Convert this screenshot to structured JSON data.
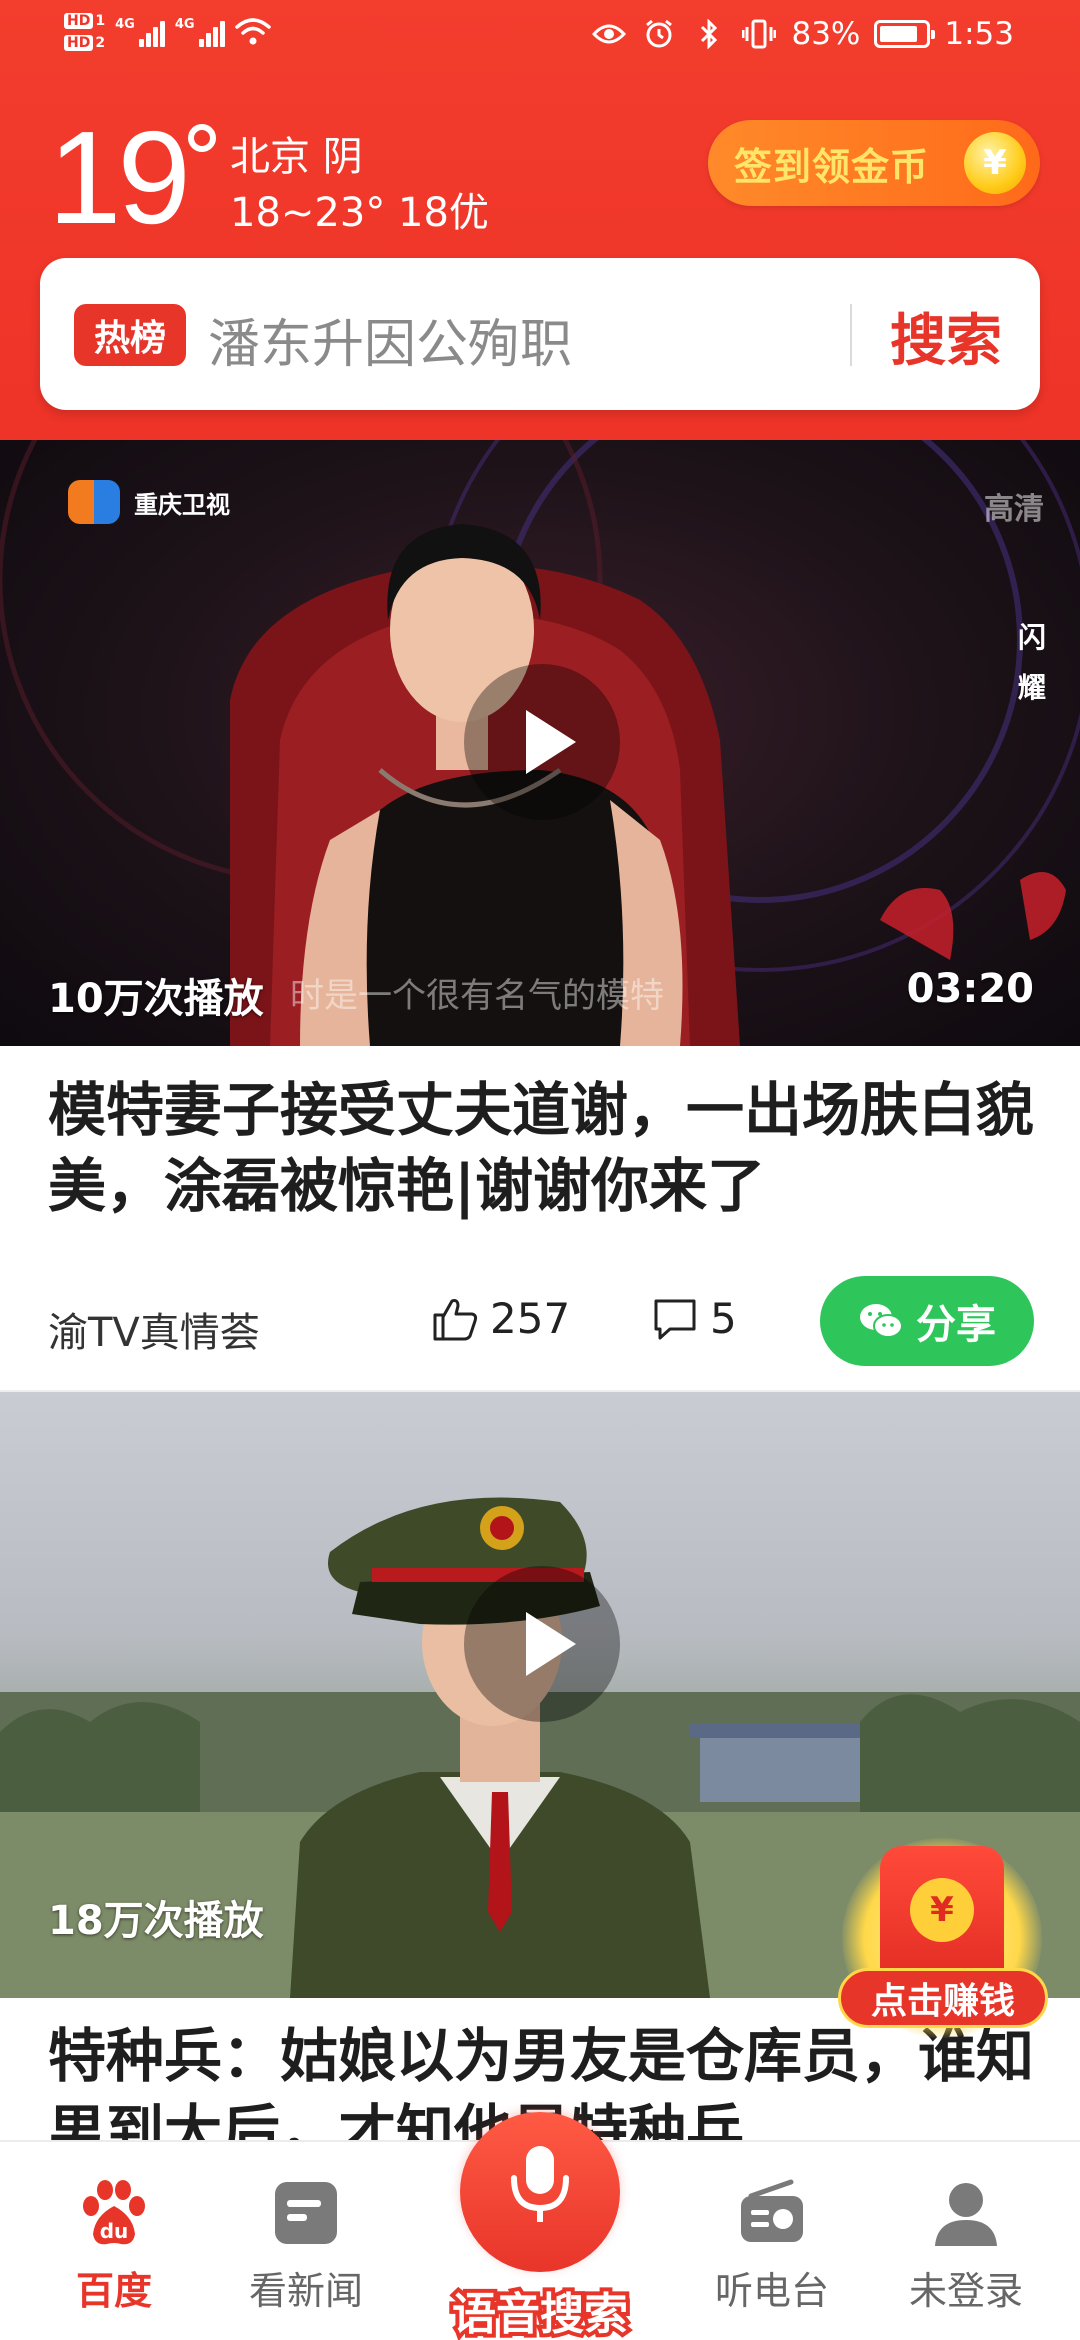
{
  "status_bar": {
    "sim1": "1",
    "sim2": "2",
    "net1": "4G",
    "net2": "4G",
    "battery_percent": "83%",
    "battery_level": 0.83,
    "time": "1:53",
    "icons": [
      "eye-icon",
      "alarm-icon",
      "bluetooth-icon",
      "vibrate-icon",
      "battery-icon"
    ]
  },
  "weather": {
    "temperature": "19",
    "city_line": "北京 阴",
    "range_line": "18~23° 18优"
  },
  "signin": {
    "label": "签到领金币",
    "coin_symbol": "¥"
  },
  "search": {
    "badge": "热榜",
    "query": "潘东升因公殉职",
    "button": "搜索"
  },
  "feed": {
    "item1": {
      "channel": "重庆卫视",
      "hd_tag": "高清",
      "side_tag_1": "闪",
      "side_tag_2": "耀",
      "subtitle": "时是一个很有名气的模特",
      "plays": "10万次播放",
      "duration": "03:20",
      "title": "模特妻子接受丈夫道谢，一出场肤白貌美，涂磊被惊艳|谢谢你来了",
      "source": "渝TV真情荟",
      "likes": "257",
      "comments": "5",
      "share": "分享"
    },
    "item2": {
      "plays": "18万次播放",
      "title": "特种兵：姑娘以为男友是仓库员，谁知男到大后，才知他是特种兵"
    }
  },
  "envelope": {
    "symbol": "¥",
    "label": "点击赚钱"
  },
  "bottom_nav": {
    "items": [
      {
        "label": "百度"
      },
      {
        "label": "看新闻"
      },
      {
        "label": "语音搜索"
      },
      {
        "label": "听电台"
      },
      {
        "label": "未登录"
      }
    ]
  },
  "colors": {
    "brand_red": "#e8352a",
    "share_green": "#2ec55a",
    "coin_gold": "#ffcc1a"
  }
}
